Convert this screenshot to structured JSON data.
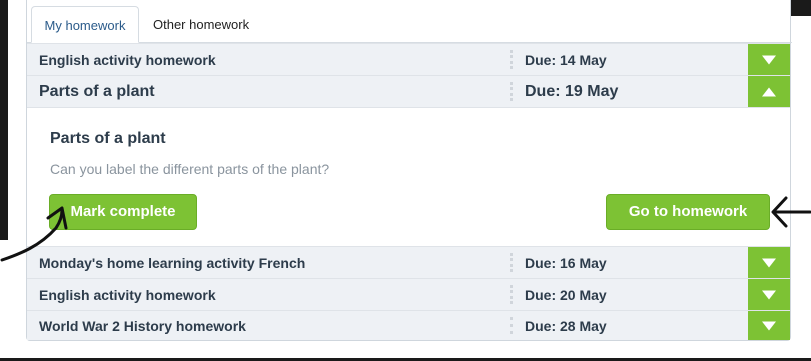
{
  "tabs": [
    {
      "label": "My homework",
      "active": true
    },
    {
      "label": "Other homework",
      "active": false
    }
  ],
  "rows_top": [
    {
      "title": "English activity homework",
      "due": "Due: 14 May",
      "expanded": false
    },
    {
      "title": "Parts of a plant",
      "due": "Due: 19 May",
      "expanded": true
    }
  ],
  "expanded": {
    "title": "Parts of a plant",
    "description": "Can you label the different parts of the plant?",
    "mark_complete_label": "Mark complete",
    "go_to_homework_label": "Go to homework"
  },
  "rows_bottom": [
    {
      "title": "Monday's home learning activity French",
      "due": "Due: 16 May",
      "expanded": false
    },
    {
      "title": "English activity homework",
      "due": "Due: 20 May",
      "expanded": false
    },
    {
      "title": "World War 2 History homework",
      "due": "Due: 28 May",
      "expanded": false
    }
  ],
  "colors": {
    "accent_green": "#7dc234",
    "row_background": "#eef1f5",
    "tab_active_text": "#2b5b8a"
  },
  "icons": {
    "collapsed": "chevron-down-icon",
    "expanded": "chevron-up-icon"
  }
}
